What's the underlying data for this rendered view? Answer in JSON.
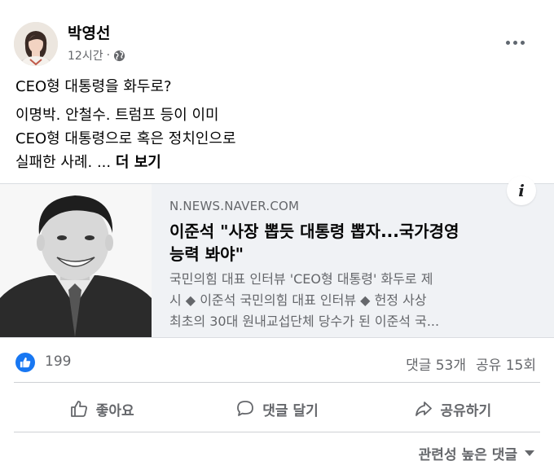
{
  "post": {
    "author": "박영선",
    "time": "12시간",
    "separator": "·",
    "privacy_icon": "globe-icon",
    "more_icon": "more-options-icon",
    "text_lines": [
      "CEO형 대통령을 화두로?",
      "이명박. 안철수. 트럼프 등이 이미",
      "CEO형 대통령으로 혹은 정치인으로",
      "실패한 사례. ..."
    ],
    "see_more": "더 보기"
  },
  "link": {
    "domain": "N.NEWS.NAVER.COM",
    "title_lines": [
      "이준석 \"사장 뽑듯 대통령 뽑자...국가경영",
      "능력 봐야\""
    ],
    "desc_lines": [
      "국민의힘 대표 인터뷰 'CEO형 대통령' 화두로 제",
      "시 ◆ 이준석 국민의힘 대표 인터뷰 ◆ 헌정 사상",
      "최초의 30대 원내교섭단체 당수가 된 이준석 국..."
    ],
    "info_icon": "i"
  },
  "stats": {
    "likes": "199",
    "comments": "댓글 53개",
    "shares": "공유 15회"
  },
  "actions": {
    "like": "좋아요",
    "comment": "댓글 달기",
    "share": "공유하기"
  },
  "sort": {
    "label": "관련성 높은 댓글"
  },
  "colors": {
    "accent": "#1877f2",
    "secondary_text": "#65676b"
  }
}
